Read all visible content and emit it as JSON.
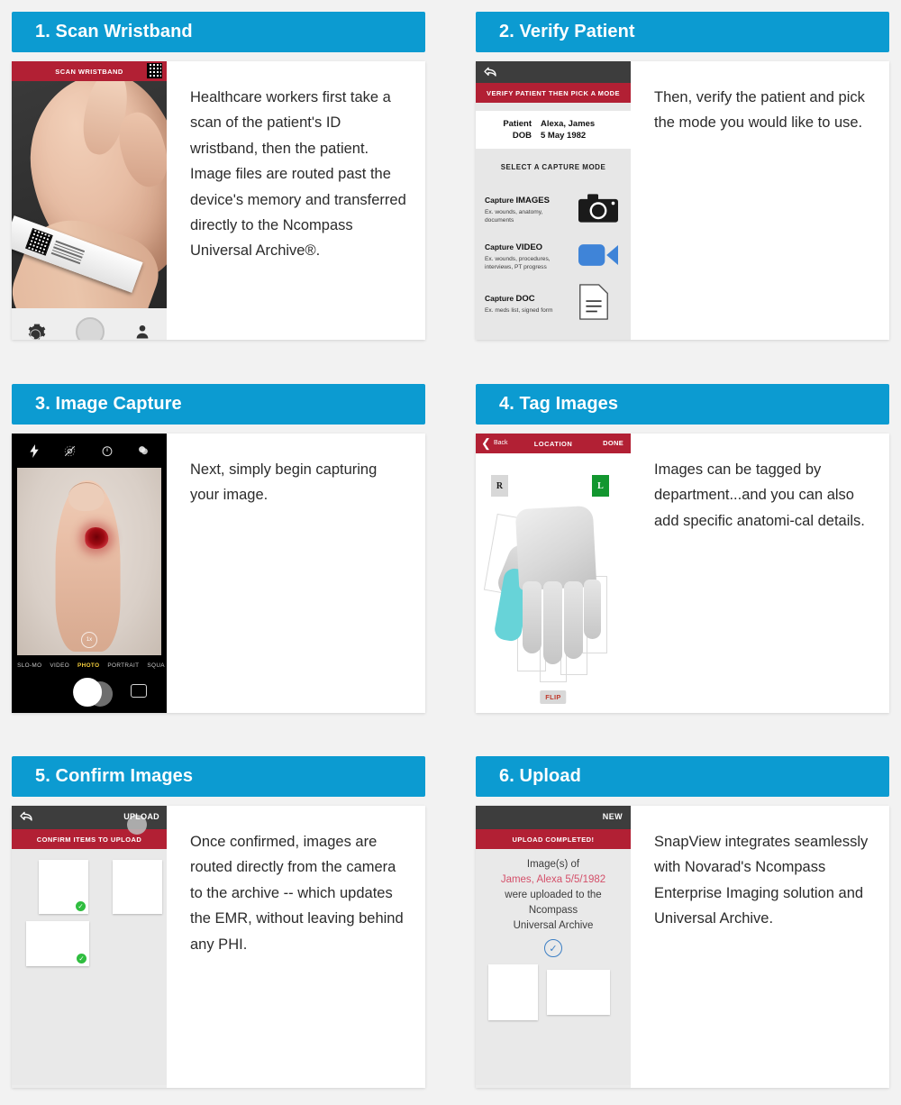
{
  "theme": {
    "header_blue": "#0c9bd1",
    "app_red": "#b22034",
    "dark_bar": "#3d3d3d",
    "accent_green": "#2fbd3f",
    "tag_green": "#12962f",
    "video_blue": "#3f84d8",
    "photo_yellow": "#f6cf3d",
    "page_bg": "#f2f2f2"
  },
  "panels": [
    {
      "id": "scan-wristband",
      "title": "1. Scan Wristband",
      "description": "Healthcare workers first take a scan of the patient's ID wristband, then the patient.  Image files are routed past the device's memory and transferred directly to the Ncompass Universal Archive®.",
      "screen": {
        "red_bar": "SCAN WRISTBAND",
        "qr_icon": "qr-code-icon",
        "toolbar": {
          "settings": "gear-icon",
          "shutter": "shutter-button",
          "profile": "person-icon"
        }
      }
    },
    {
      "id": "verify-patient",
      "title": "2. Verify Patient",
      "description": "Then, verify the patient and pick the mode you would like to use.",
      "screen": {
        "back_icon": "back-arrow-icon",
        "red_bar": "VERIFY PATIENT THEN PICK A MODE",
        "fields": [
          {
            "label": "Patient",
            "value": "Alexa, James"
          },
          {
            "label": "DOB",
            "value": "5 May 1982"
          }
        ],
        "modes_title": "SELECT A CAPTURE MODE",
        "modes": [
          {
            "prefix": "Capture ",
            "name": "IMAGES",
            "examples": "Ex. wounds, anatomy, documents",
            "icon": "camera-icon"
          },
          {
            "prefix": "Capture ",
            "name": "VIDEO",
            "examples": "Ex. wounds, procedures, interviews, PT progress",
            "icon": "video-camera-icon"
          },
          {
            "prefix": "Capture ",
            "name": "DOC",
            "examples": "Ex. meds list, signed form",
            "icon": "document-icon"
          }
        ]
      }
    },
    {
      "id": "image-capture",
      "title": "3. Image Capture",
      "description": "Next, simply begin capturing your image.",
      "screen": {
        "top_icons": [
          "flash-icon",
          "live-photo-off-icon",
          "timer-icon",
          "filters-icon"
        ],
        "zoom_label": "1x",
        "modes": [
          "SLO-MO",
          "VIDEO",
          "PHOTO",
          "PORTRAIT",
          "SQUA"
        ],
        "active_mode": "PHOTO",
        "shutter": "shutter-button",
        "flip": "flip-camera-icon"
      }
    },
    {
      "id": "tag-images",
      "title": "4. Tag Images",
      "description": "Images can be tagged by department...and you can also add specific anatomi-cal details.",
      "screen": {
        "back_label": "Back",
        "nav_title": "LOCATION",
        "done_label": "DONE",
        "side_right": "R",
        "side_left": "L",
        "flip_label": "FLIP"
      }
    },
    {
      "id": "confirm-images",
      "title": "5. Confirm Images",
      "description": "Once confirmed, images are routed directly from the camera to the archive -- which updates the EMR, without leaving behind any PHI.",
      "screen": {
        "back_icon": "back-arrow-icon",
        "upload_label": "UPLOAD",
        "red_bar": "CONFIRM ITEMS TO UPLOAD",
        "thumbnails": [
          {
            "name": "finger-wound-thumbnail",
            "checked": true,
            "check_icon": "check-circle-icon"
          },
          {
            "name": "finger-wound-thumbnail",
            "checked": false,
            "check_icon": ""
          },
          {
            "name": "arm-wound-thumbnail",
            "checked": true,
            "check_icon": "check-circle-icon"
          }
        ]
      }
    },
    {
      "id": "upload",
      "title": "6. Upload",
      "description": "SnapView integrates seamlessly with Novarad's Ncompass Enterprise Imaging solution and Universal Archive.",
      "screen": {
        "new_label": "NEW",
        "red_bar": "UPLOAD COMPLETED!",
        "message_line1": "Image(s) of",
        "message_patient": "James, Alexa 5/5/1982",
        "message_line2": "were uploaded to the",
        "message_line3": "Ncompass",
        "message_line4": "Universal Archive",
        "check_icon": "check-circle-outline-icon",
        "thumbnails": [
          {
            "name": "finger-wound-thumbnail"
          },
          {
            "name": "arm-wound-thumbnail"
          }
        ]
      }
    }
  ]
}
